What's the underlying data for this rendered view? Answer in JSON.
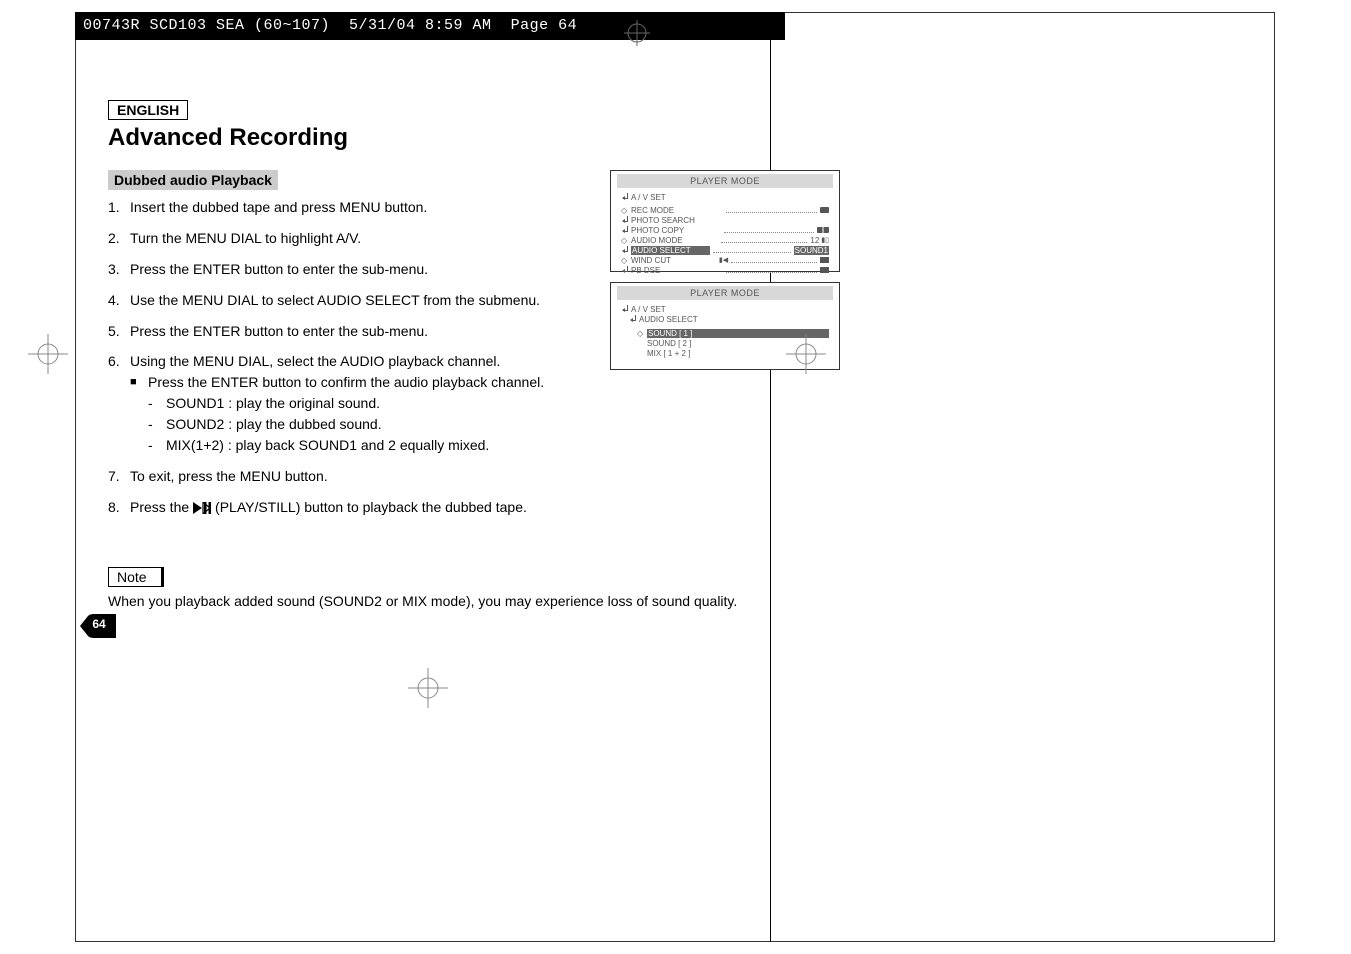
{
  "header": {
    "job": "00743R SCD103 SEA (60~107)  5/31/04 8:59 AM  Page 64"
  },
  "lang": "ENGLISH",
  "title": "Advanced Recording",
  "subheading": "Dubbed audio Playback",
  "steps": {
    "s1_num": "1.",
    "s1": "Insert the dubbed tape and press MENU button.",
    "s2_num": "2.",
    "s2": "Turn the MENU DIAL to highlight A/V.",
    "s3_num": "3.",
    "s3": "Press the ENTER button to enter the sub-menu.",
    "s4_num": "4.",
    "s4": "Use the MENU DIAL to select AUDIO SELECT from the submenu.",
    "s5_num": "5.",
    "s5": "Press the ENTER button to enter the sub-menu.",
    "s6_num": "6.",
    "s6": "Using the MENU DIAL, select the AUDIO playback channel.",
    "s6a": "Press the ENTER button to confirm the audio playback channel.",
    "s6a1": "SOUND1 : play the original sound.",
    "s6a2": "SOUND2 : play the dubbed sound.",
    "s6a3": "MIX(1+2) : play back SOUND1 and 2 equally mixed.",
    "s7_num": "7.",
    "s7": "To exit, press the MENU button.",
    "s8_num": "8.",
    "s8a": "Press the ",
    "s8b": "(PLAY/STILL) button to playback the dubbed tape."
  },
  "note": {
    "label": "Note",
    "text": "When you playback added sound (SOUND2 or MIX mode), you may experience loss of sound quality."
  },
  "menu1": {
    "title": "PLAYER  MODE",
    "avset": "A / V SET",
    "rec_mode": "REC MODE",
    "photo_search": "PHOTO SEARCH",
    "photo_copy": "PHOTO COPY",
    "audio_mode": "AUDIO MODE",
    "audio_mode_val": "12",
    "audio_select": "AUDIO SELECT",
    "audio_select_val": "SOUND1",
    "wind_cut": "WIND CUT",
    "pb_dse": "PB DSE"
  },
  "menu2": {
    "title": "PLAYER  MODE",
    "avset": "A / V SET",
    "audio_select": "AUDIO SELECT",
    "sound1": "SOUND [ 1 ]",
    "sound2": "SOUND [ 2 ]",
    "mix": "MIX [ 1 + 2 ]"
  },
  "page_number": "64"
}
